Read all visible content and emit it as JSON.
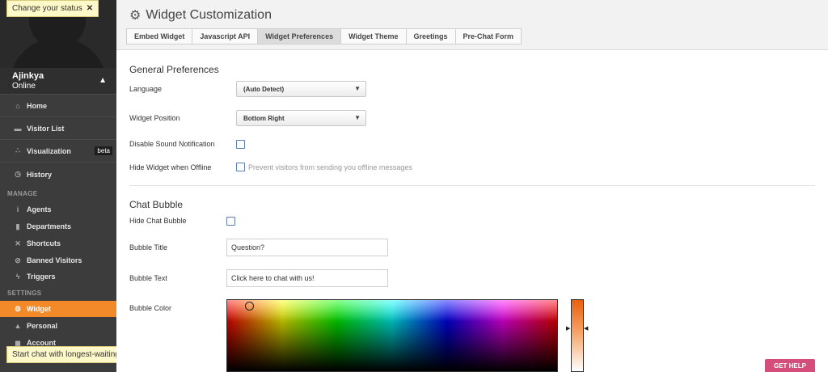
{
  "user": {
    "name": "Ajinkya",
    "status": "Online"
  },
  "tooltips": {
    "status": "Change your status",
    "chat": "Start chat with longest-waiting visitor",
    "close": "✕"
  },
  "nav": {
    "home": "Home",
    "visitor_list": "Visitor List",
    "visualization": "Visualization",
    "beta": "beta",
    "history": "History",
    "manage_header": "MANAGE",
    "agents": "Agents",
    "departments": "Departments",
    "shortcuts": "Shortcuts",
    "banned_visitors": "Banned Visitors",
    "triggers": "Triggers",
    "settings_header": "SETTINGS",
    "widget": "Widget",
    "personal": "Personal",
    "account": "Account"
  },
  "header": {
    "title": "Widget Customization",
    "tabs": [
      "Embed Widget",
      "Javascript API",
      "Widget Preferences",
      "Widget Theme",
      "Greetings",
      "Pre-Chat Form"
    ],
    "active_tab": "Widget Preferences"
  },
  "general": {
    "title": "General Preferences",
    "language_label": "Language",
    "language_value": "(Auto Detect)",
    "position_label": "Widget Position",
    "position_value": "Bottom Right",
    "sound_label": "Disable Sound Notification",
    "sound_checked": false,
    "offline_label": "Hide Widget when Offline",
    "offline_checked": false,
    "offline_hint": "Prevent visitors from sending you offline messages"
  },
  "bubble": {
    "title": "Chat Bubble",
    "hide_label": "Hide Chat Bubble",
    "hide_checked": false,
    "title_label": "Bubble Title",
    "title_value": "Question?",
    "text_label": "Bubble Text",
    "text_value": "Click here to chat with us!",
    "color_label": "Bubble Color",
    "color_value": "#e8600e"
  },
  "help_button": "GET HELP",
  "colors": {
    "accent": "#f28a2a",
    "sidebar": "#3c3c3c",
    "help": "#d54d7b"
  }
}
